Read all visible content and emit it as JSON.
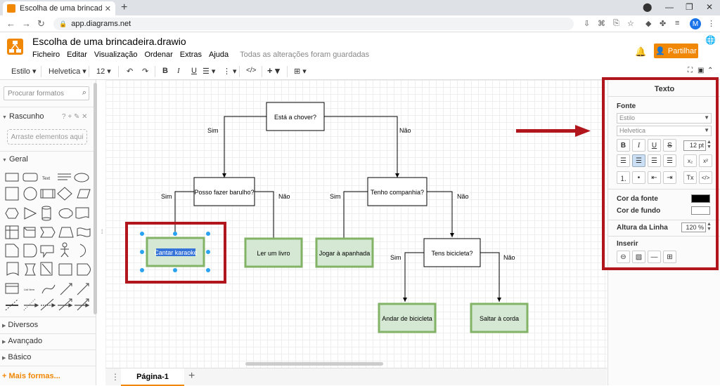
{
  "browser": {
    "tab_title": "Escolha de uma brincadeira.drawio",
    "url": "app.diagrams.net",
    "avatar": "M"
  },
  "app": {
    "title": "Escolha de uma brincadeira.drawio",
    "menus": [
      "Ficheiro",
      "Editar",
      "Visualização",
      "Ordenar",
      "Extras",
      "Ajuda"
    ],
    "status": "Todas as alterações foram guardadas",
    "share": "Partilhar"
  },
  "toolbar": {
    "style": "Estilo",
    "font": "Helvetica",
    "size": "12",
    "bold": "B",
    "italic": "I",
    "underline": "U",
    "code": "</>",
    "add": "+"
  },
  "sidebar": {
    "search_placeholder": "Procurar formatos",
    "scratch": "Rascunho",
    "scratch_tools": "? + ✎ ✕",
    "drag_hint": "Arraste elementos aqui",
    "general": "Geral",
    "text_shape": "Text",
    "list_item": "List Item",
    "sections": [
      "Diversos",
      "Avançado",
      "Básico"
    ],
    "more": "+ Mais formas..."
  },
  "diagram": {
    "nodes": {
      "chover": "Está a chover?",
      "barulho": "Posso fazer barulho?",
      "companhia": "Tenho companhia?",
      "karaoke": "Cantar karaoke",
      "livro": "Ler um livro",
      "apanhada": "Jogar à apanhada",
      "bicicleta_q": "Tens bicicleta?",
      "andar": "Andar de bicicleta",
      "corda": "Saltar à corda"
    },
    "labels": {
      "sim1": "Sim",
      "nao1": "Não",
      "sim2": "Sim",
      "nao2": "Não",
      "sim3": "Sim",
      "nao3": "Não",
      "sim4": "Sim",
      "nao4": "Não"
    },
    "colors": {
      "leaf_fill": "#d5e8d4",
      "leaf_stroke": "#82b366",
      "highlight": "#b0161c",
      "handle": "#29a2f2"
    }
  },
  "pages": {
    "current": "Página-1"
  },
  "panel": {
    "title": "Texto",
    "font_label": "Fonte",
    "style_select": "Estilo",
    "font_select": "Helvetica",
    "font_size": "12 pt",
    "font_color_label": "Cor da fonte",
    "bg_color_label": "Cor de fundo",
    "line_height_label": "Altura da Linha",
    "line_height": "120 %",
    "insert_label": "Inserir"
  }
}
